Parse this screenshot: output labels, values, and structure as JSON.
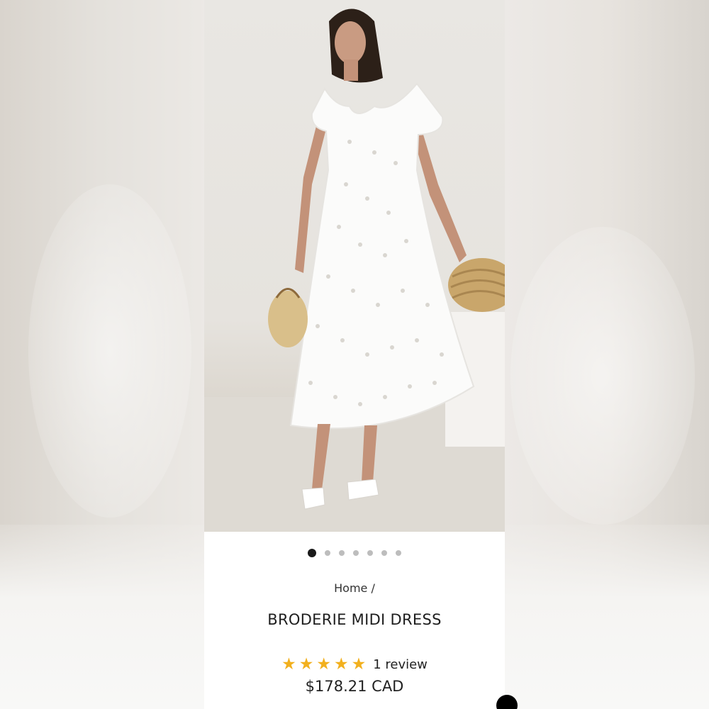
{
  "product": {
    "breadcrumb": "Home /",
    "title": "BRODERIE MIDI DRESS",
    "rating_stars": 5,
    "review_text": "1 review",
    "price": "$178.21 CAD"
  },
  "gallery": {
    "image_count": 7,
    "active_index": 0,
    "image_alt": "Woman in white broderie midi dress holding straw bag"
  },
  "colors": {
    "star": "#f2b01e",
    "active_dot": "#1a1a1a",
    "inactive_dot": "#bdbdbd"
  }
}
